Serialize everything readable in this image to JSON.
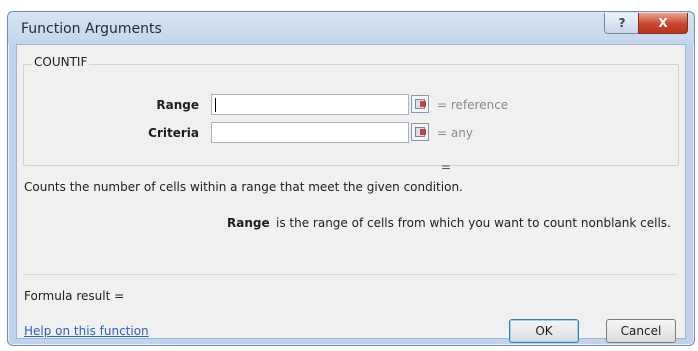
{
  "window": {
    "title": "Function Arguments"
  },
  "title_buttons": {
    "help_glyph": "?",
    "close_glyph": "X"
  },
  "function_group": {
    "name": "COUNTIF",
    "args": [
      {
        "label": "Range",
        "value": "",
        "result": "=  reference"
      },
      {
        "label": "Criteria",
        "value": "",
        "result": "=  any"
      }
    ],
    "overall_result": "="
  },
  "description": "Counts the number of cells within a range that meet the given condition.",
  "arg_help": {
    "name": "Range",
    "text": "is the range of cells from which you want to count nonblank cells."
  },
  "formula_result_label": "Formula result =",
  "help_link": "Help on this function",
  "buttons": {
    "ok": "OK",
    "cancel": "Cancel"
  }
}
